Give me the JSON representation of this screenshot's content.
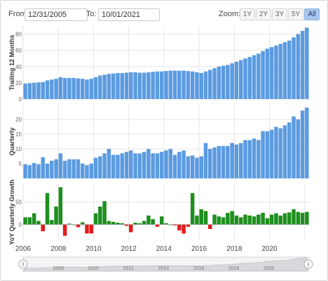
{
  "range_selector": {
    "from_label": "From:",
    "from_value": "12/31/2005",
    "to_label": "To:",
    "to_value": "10/01/2021",
    "zoom_label": "Zoom:",
    "zoom_options": [
      "1Y",
      "2Y",
      "3Y",
      "5Y",
      "All"
    ],
    "selected_zoom": "All"
  },
  "navigator": {
    "labels": [
      "2008",
      "2010",
      "2012",
      "2014",
      "2016",
      "2018",
      "2020"
    ],
    "from_fraction": 0,
    "to_fraction": 1
  },
  "colors": {
    "bar_blue": "#5b9be0",
    "positive": "#1e8f1e",
    "negative": "#e3191c",
    "grid": "#e6e6e6",
    "navigator_fill": "#d7d9dc"
  },
  "chart_data": [
    {
      "type": "bar",
      "ylabel": "Trailing 12 Months",
      "ylim": [
        0,
        90
      ],
      "yticks": [
        "0",
        "20",
        "40",
        "60",
        "80"
      ],
      "x_start": "2006-01",
      "x_period": "quarter",
      "xtick_labels": [
        "2006",
        "2008",
        "2010",
        "2012",
        "2014",
        "2016",
        "2018",
        "2020"
      ],
      "values": [
        19,
        19.5,
        20,
        20.5,
        21,
        23,
        24,
        25,
        27,
        26,
        26,
        26,
        25.5,
        25,
        24,
        25,
        27,
        29,
        30,
        31,
        31.5,
        32,
        32,
        32.5,
        33,
        33,
        32.5,
        32.5,
        33,
        33.5,
        34,
        34,
        34.5,
        35,
        35,
        35,
        35,
        34.5,
        34,
        33,
        32,
        34,
        36,
        38,
        40,
        41,
        42,
        44,
        46,
        48,
        50,
        52,
        54,
        56,
        59,
        62,
        64,
        66,
        68,
        70,
        72,
        76,
        80,
        84,
        88
      ]
    },
    {
      "type": "bar",
      "ylabel": "Quarterly",
      "ylim": [
        0,
        25
      ],
      "yticks": [
        "5",
        "10",
        "15",
        "20"
      ],
      "x_start": "2006-01",
      "x_period": "quarter",
      "xtick_labels": [
        "2006",
        "2008",
        "2010",
        "2012",
        "2014",
        "2016",
        "2018",
        "2020"
      ],
      "values": [
        4.8,
        4.5,
        5.2,
        4.8,
        7.2,
        5.0,
        6.0,
        6.5,
        8.5,
        6.0,
        6.5,
        6.5,
        6.5,
        5.0,
        4.5,
        5.0,
        7.0,
        7.5,
        8.5,
        10.0,
        8.0,
        8.0,
        8.5,
        9.0,
        9.5,
        8.5,
        8.5,
        9.0,
        10.0,
        8.5,
        8.5,
        9.0,
        9.5,
        10.0,
        8.0,
        9.0,
        9.5,
        7.5,
        7.8,
        7.0,
        7.5,
        12.0,
        10.0,
        10.5,
        11.0,
        11.0,
        11.0,
        12.0,
        11.5,
        12.0,
        13.0,
        13.0,
        13.5,
        13.0,
        16.0,
        16.0,
        16.5,
        17.5,
        17.0,
        18.0,
        19.0,
        21.0,
        20.0,
        23.0,
        24.0
      ]
    },
    {
      "type": "bar",
      "ylabel": "YoY Quarterly Growth",
      "ylim": [
        -35,
        90
      ],
      "yticks": [
        "0",
        "50"
      ],
      "x_start": "2006-01",
      "x_period": "quarter",
      "xtick_labels": [
        "2006",
        "2008",
        "2010",
        "2012",
        "2014",
        "2016",
        "2018",
        "2020"
      ],
      "values": [
        16,
        16,
        25,
        8,
        -15,
        70,
        10,
        40,
        83,
        -25,
        2,
        0,
        -6,
        5,
        -20,
        -20,
        25,
        40,
        52,
        8,
        6,
        4,
        3,
        -3,
        -17,
        4,
        3,
        8,
        20,
        12,
        -5,
        18,
        3,
        0,
        -2,
        -13,
        -20,
        -5,
        70,
        20,
        34,
        30,
        -10,
        22,
        18,
        16,
        26,
        30,
        20,
        16,
        22,
        20,
        18,
        22,
        26,
        14,
        22,
        25,
        20,
        25,
        27,
        34,
        28,
        26,
        28
      ]
    }
  ]
}
